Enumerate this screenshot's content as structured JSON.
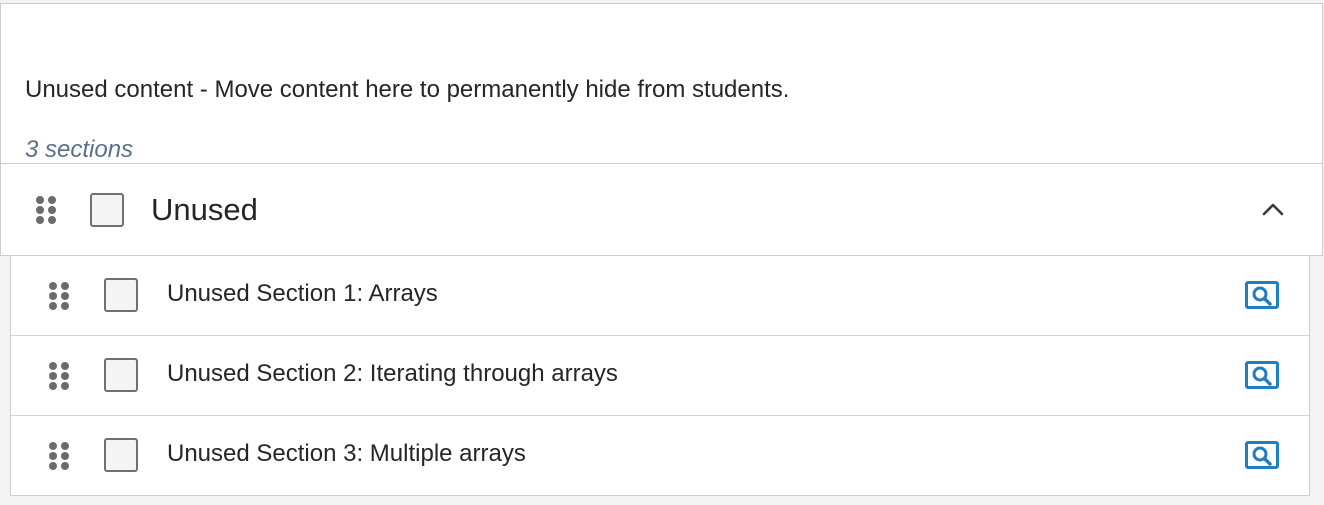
{
  "container": {
    "description": "Unused content - Move content here to permanently hide from students.",
    "section_count": "3 sections",
    "title": "Unused",
    "expanded": true
  },
  "sections": [
    {
      "label": "Unused Section 1: Arrays"
    },
    {
      "label": "Unused Section 2: Iterating through arrays"
    },
    {
      "label": "Unused Section 3: Multiple arrays"
    }
  ],
  "icons": {
    "drag": "drag-handle-icon",
    "collapse": "chevron-up-icon",
    "preview": "preview-search-icon"
  },
  "colors": {
    "accent": "#1f7fc2",
    "muted_text": "#5b6e8a",
    "border": "#cdcdcd"
  }
}
